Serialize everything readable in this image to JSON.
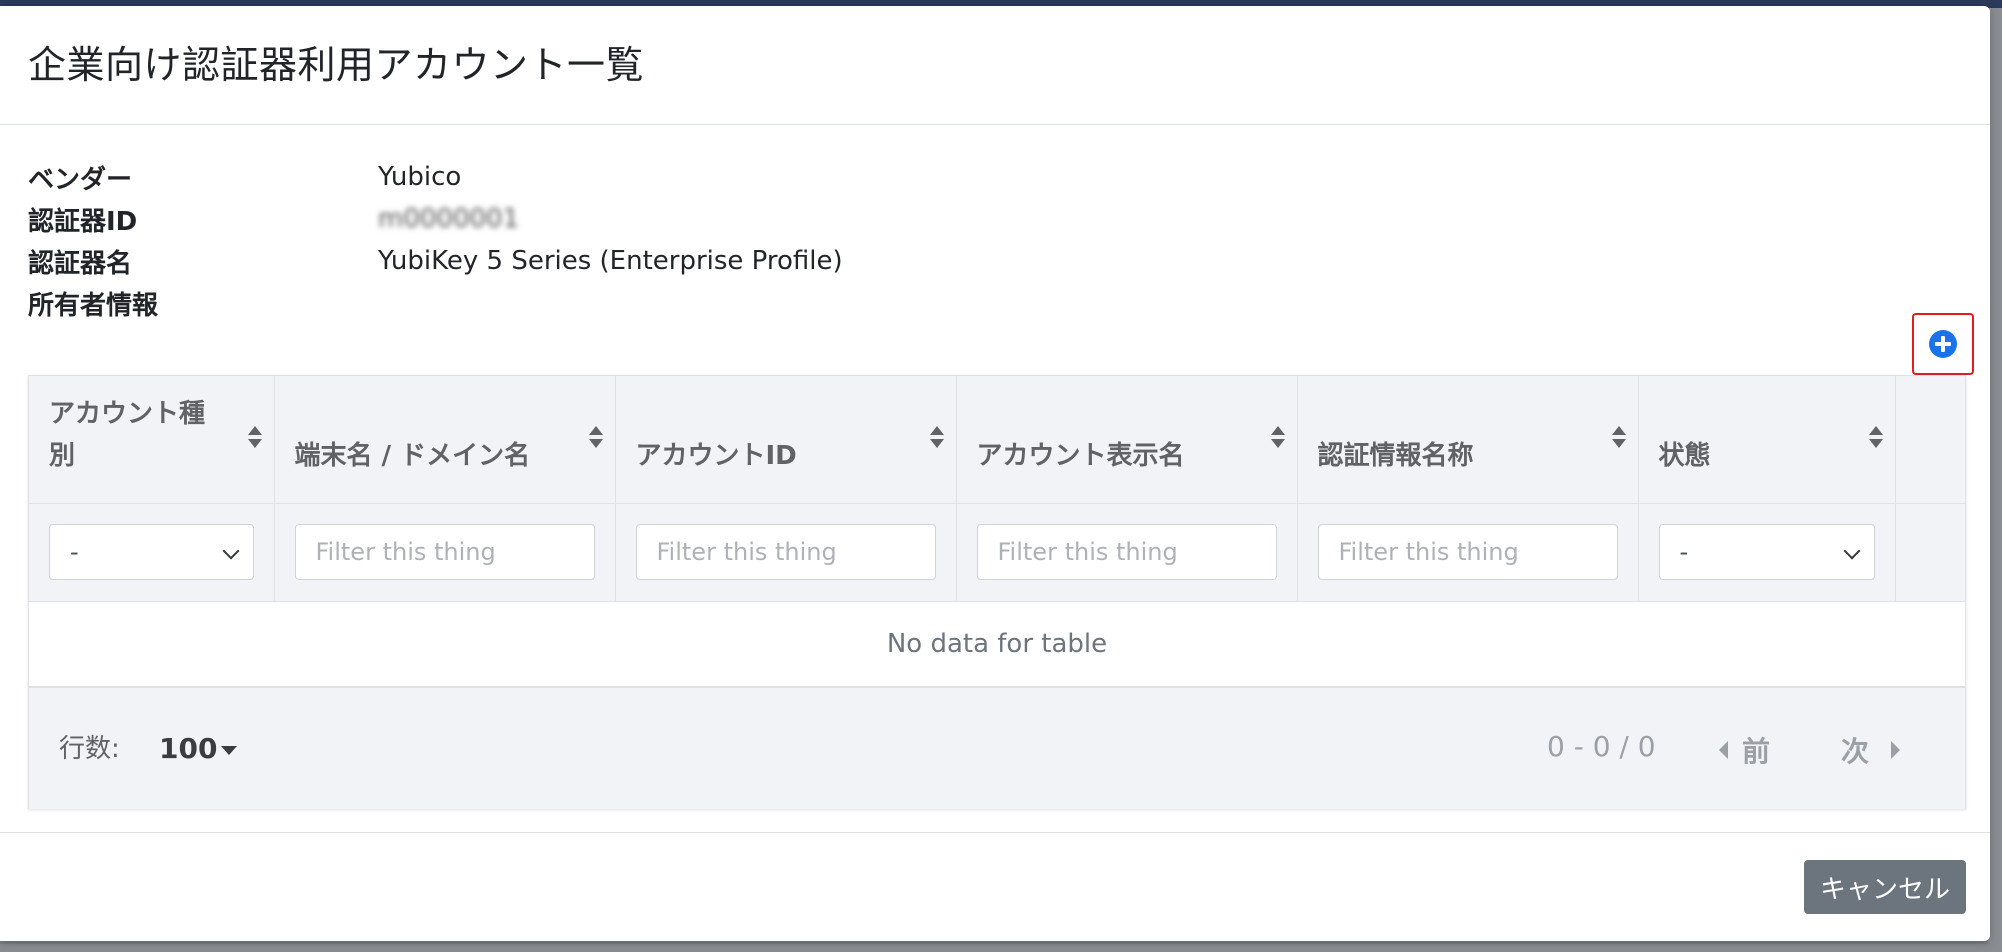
{
  "modal": {
    "title": "企業向け認証器利用アカウント一覧"
  },
  "info": {
    "vendor_label": "ベンダー",
    "vendor_value": "Yubico",
    "authenticator_id_label": "認証器ID",
    "authenticator_id_value": "m0000001",
    "authenticator_name_label": "認証器名",
    "authenticator_name_value": "YubiKey 5 Series (Enterprise Profile)",
    "owner_label": "所有者情報",
    "owner_value": ""
  },
  "add_button": {
    "icon": "plus-circle-icon",
    "color": "#1a73e8"
  },
  "table": {
    "columns": [
      "アカウント種別",
      "端末名 / ドメイン名",
      "アカウントID",
      "アカウント表示名",
      "認証情報名称",
      "状態"
    ],
    "filters": {
      "account_type_selected": "-",
      "placeholder": "Filter this thing",
      "status_selected": "-"
    },
    "empty_message": "No data for table"
  },
  "pagination": {
    "rows_label": "行数:",
    "rows_value": "100",
    "range": "0 - 0 / 0",
    "prev_label": "前",
    "next_label": "次"
  },
  "footer": {
    "cancel_label": "キャンセル"
  }
}
